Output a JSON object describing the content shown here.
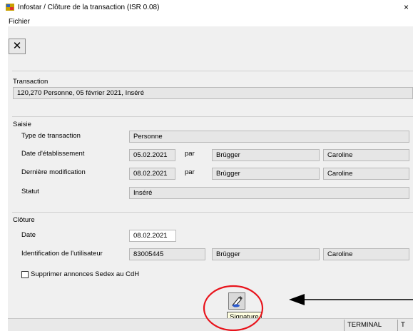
{
  "window": {
    "title": "Infostar / Clôture de la transaction (ISR 0.08)",
    "close_glyph": "×"
  },
  "menu": {
    "file": "Fichier"
  },
  "toolbar": {
    "close_glyph": "✕"
  },
  "transaction": {
    "section": "Transaction",
    "value": "120,270  Personne, 05 février 2021, Inséré"
  },
  "saisie": {
    "section": "Saisie",
    "type_label": "Type de transaction",
    "type_value": "Personne",
    "creation_label": "Date d'établissement",
    "creation_date": "05.02.2021",
    "creation_par": "par",
    "creation_last": "Brügger",
    "creation_first": "Caroline",
    "modif_label": "Dernière modification",
    "modif_date": "08.02.2021",
    "modif_par": "par",
    "modif_last": "Brügger",
    "modif_first": "Caroline",
    "statut_label": "Statut",
    "statut_value": "Inséré"
  },
  "cloture": {
    "section": "Clôture",
    "date_label": "Date",
    "date_value": "08.02.2021",
    "user_label": "Identification de l'utilisateur",
    "user_id": "83005445",
    "user_last": "Brügger",
    "user_first": "Caroline",
    "sedex_label": "Supprimer annonces Sedex au CdH",
    "sedex_checked": false
  },
  "signature": {
    "tooltip": "Signature"
  },
  "status_bar": {
    "terminal": "TERMINAL",
    "last": "T"
  },
  "annotation_colors": {
    "circle": "#e8141c",
    "arrow": "#000000"
  }
}
